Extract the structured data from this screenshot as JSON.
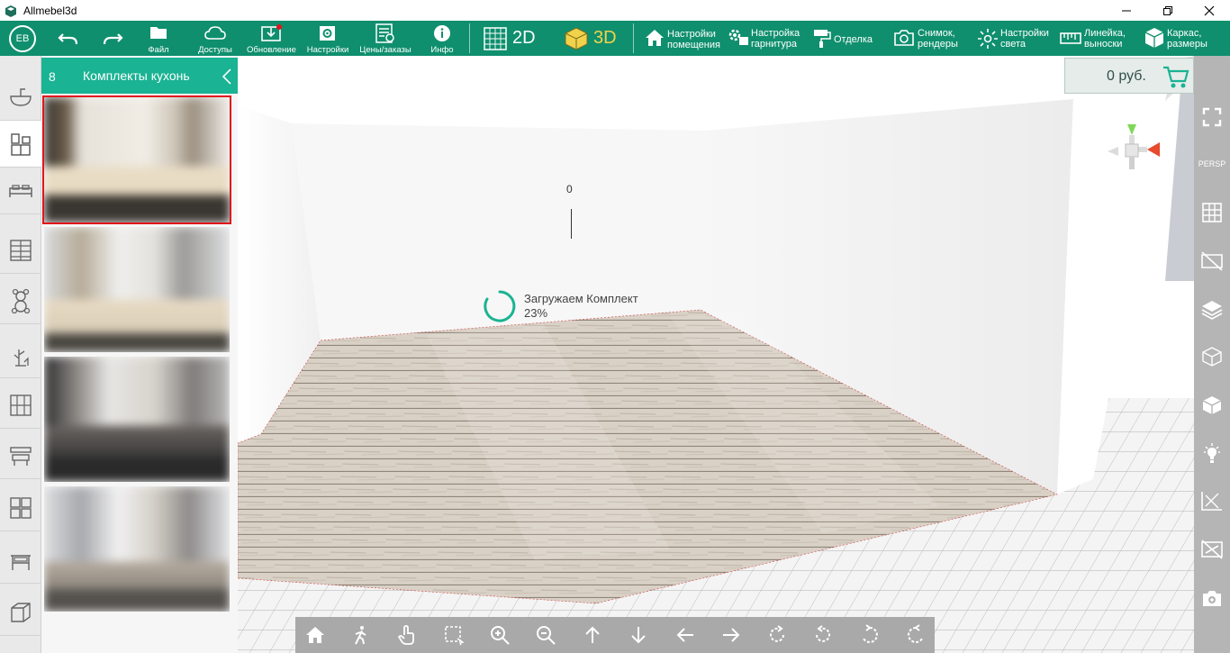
{
  "window": {
    "title": "Allmebel3d",
    "controls": {
      "minimize": "minimize-icon",
      "maximize": "restore-icon",
      "close": "close-icon"
    }
  },
  "toolbar": {
    "avatar": "EB",
    "undo": "undo-icon",
    "redo": "redo-icon",
    "file_label": "Файл",
    "access_label": "Доступы",
    "update_label": "Обновление",
    "settings_label": "Настройки",
    "prices_label": "Цены/заказы",
    "info_label": "Инфо",
    "mode_2d": "2D",
    "mode_3d": "3D",
    "room_settings": [
      "Настройки",
      "помещения"
    ],
    "set_settings": [
      "Настройка",
      "гарнитура"
    ],
    "finish_label": "Отделка",
    "snapshot": [
      "Снимок,",
      "рендеры"
    ],
    "light": [
      "Настройки",
      "света"
    ],
    "ruler": [
      "Линейка,",
      "выноски"
    ],
    "frame": [
      "Каркас,",
      "размеры"
    ],
    "accent_color": "#0f8f6e",
    "update_badge_color": "#e0141c",
    "mode_3d_color": "#f1d24a"
  },
  "catalog": {
    "count": "8",
    "title": "Комплекты кухонь",
    "selected_index": 0,
    "thumbnails": [
      "kitchen-set-1",
      "kitchen-set-2",
      "kitchen-set-3",
      "kitchen-set-4"
    ]
  },
  "viewport": {
    "loading_text": "Загружаем Комплект",
    "loading_progress": "23%",
    "dimension_label": "0",
    "price": "0 руб.",
    "view_mode": "PERSP"
  },
  "left_categories": [
    "sink-icon",
    "cabinet-icon",
    "bed-icon",
    "wardrobe-icon",
    "toy-icon",
    "plant-icon",
    "shelving-icon",
    "desk-icon",
    "modules-icon",
    "table-icon",
    "box-icon"
  ],
  "right_tools": [
    "fullscreen-icon",
    "persp-label",
    "grid-icon",
    "hide-wall-icon",
    "textures-icon",
    "wireframe-icon",
    "solid-icon",
    "light-icon",
    "dimensions-icon",
    "no-dimensions-icon",
    "camera-icon"
  ],
  "bottom_tools": [
    "home-icon",
    "walk-icon",
    "hand-icon",
    "select-icon",
    "zoom-in-icon",
    "zoom-out-icon",
    "move-up-icon",
    "move-down-icon",
    "move-left-icon",
    "move-right-icon",
    "rotate-cw-icon",
    "rotate-ccw-icon",
    "rotate-left-icon",
    "rotate-right-icon"
  ]
}
